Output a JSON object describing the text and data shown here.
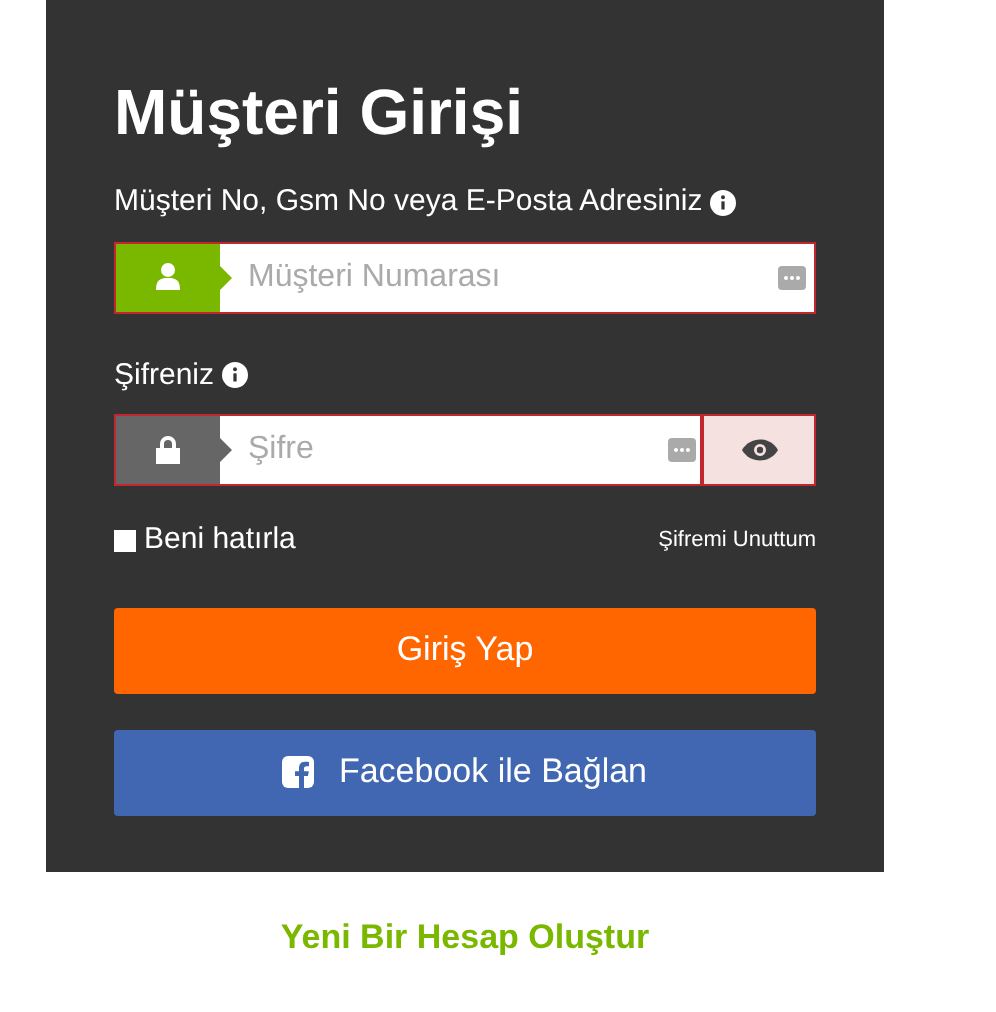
{
  "title": "Müşteri Girişi",
  "username": {
    "label": "Müşteri No, Gsm No veya E-Posta Adresiniz",
    "placeholder": "Müşteri Numarası"
  },
  "password": {
    "label": "Şifreniz",
    "placeholder": "Şifre"
  },
  "remember": {
    "label": "Beni hatırla",
    "checked": false
  },
  "forgot_link": "Şifremi Unuttum",
  "login_button": "Giriş Yap",
  "facebook_button": "Facebook ile Bağlan",
  "register_link": "Yeni Bir Hesap Oluştur"
}
